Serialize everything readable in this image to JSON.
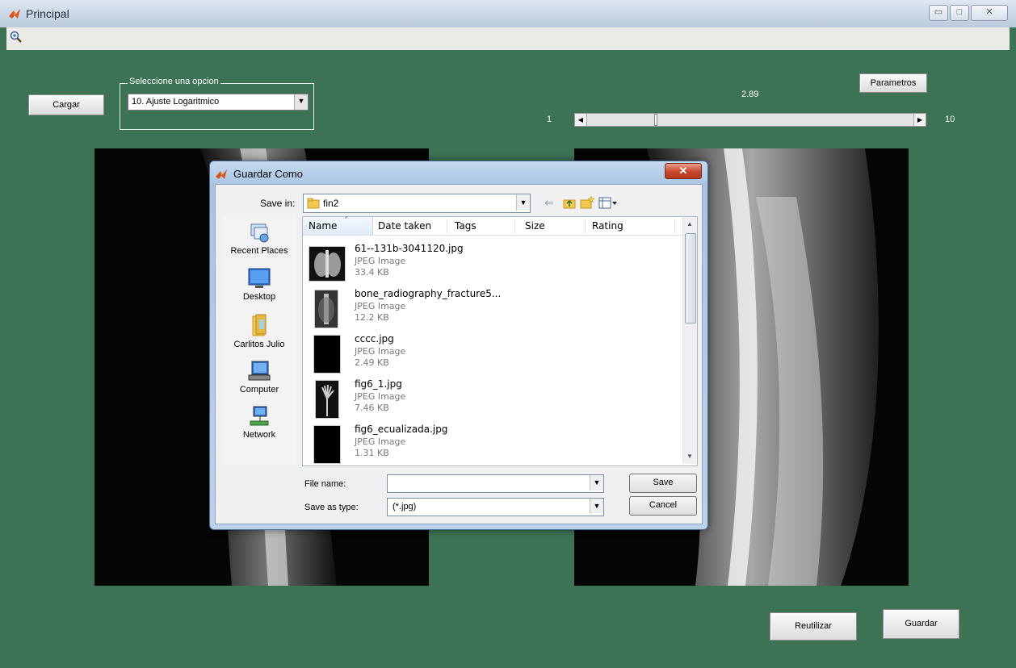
{
  "window": {
    "title": "Principal"
  },
  "controls": {
    "cargar_label": "Cargar",
    "panel_title": "Seleccione una opcion",
    "option_selected": "10. Ajuste Logaritmico",
    "parametros_label": "Parametros",
    "slider_value": "2.89",
    "slider_min": "1",
    "slider_max": "10",
    "slider_fraction": 0.21,
    "reutilizar_label": "Reutilizar",
    "guardar_label": "Guardar"
  },
  "dialog": {
    "title": "Guardar Como",
    "save_in_label": "Save in:",
    "save_in_value": "fin2",
    "places": [
      {
        "label": "Recent Places",
        "icon": "recent-places-icon"
      },
      {
        "label": "Desktop",
        "icon": "desktop-icon"
      },
      {
        "label": "Carlitos Julio",
        "icon": "user-folder-icon"
      },
      {
        "label": "Computer",
        "icon": "computer-icon"
      },
      {
        "label": "Network",
        "icon": "network-icon"
      }
    ],
    "columns": [
      "Name",
      "Date taken",
      "Tags",
      "Size",
      "Rating"
    ],
    "files": [
      {
        "name": "61--131b-3041120.jpg",
        "type": "JPEG Image",
        "size": "33.4 KB"
      },
      {
        "name": "bone_radiography_fracture5...",
        "type": "JPEG Image",
        "size": "12.2 KB"
      },
      {
        "name": "cccc.jpg",
        "type": "JPEG Image",
        "size": "2.49 KB"
      },
      {
        "name": "fig6_1.jpg",
        "type": "JPEG Image",
        "size": "7.46 KB"
      },
      {
        "name": "fig6_ecualizada.jpg",
        "type": "JPEG Image",
        "size": "1.31 KB"
      }
    ],
    "file_name_label": "File name:",
    "file_name_value": "",
    "save_type_label": "Save as type:",
    "save_type_value": "(*.jpg)",
    "save_label": "Save",
    "cancel_label": "Cancel"
  }
}
